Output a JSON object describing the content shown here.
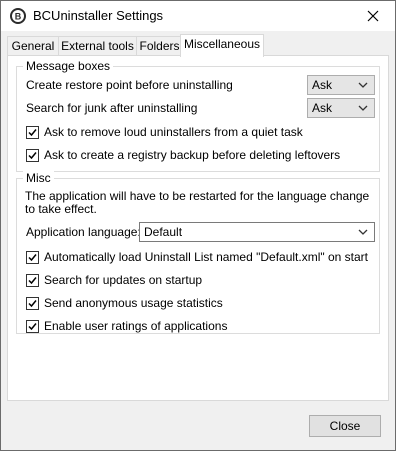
{
  "window": {
    "title": "BCUninstaller Settings",
    "close_glyph": "✕"
  },
  "tabs": [
    {
      "label": "General",
      "active": false
    },
    {
      "label": "External tools",
      "active": false
    },
    {
      "label": "Folders",
      "active": false
    },
    {
      "label": "Miscellaneous",
      "active": true
    }
  ],
  "message_boxes": {
    "group_label": "Message boxes",
    "restore_point_label": "Create restore point before uninstalling",
    "restore_point_value": "Ask",
    "junk_label": "Search for junk after uninstalling",
    "junk_value": "Ask",
    "checkboxes": [
      {
        "label": "Ask to remove loud uninstallers from a quiet task",
        "checked": true
      },
      {
        "label": "Ask to create a registry backup before deleting leftovers",
        "checked": true
      }
    ]
  },
  "misc": {
    "group_label": "Misc",
    "restart_note": "The application will have to be restarted  for the language change to take effect.",
    "language_label": "Application language:",
    "language_value": "Default",
    "checkboxes": [
      {
        "label": "Automatically load Uninstall List named \"Default.xml\" on start",
        "checked": true
      },
      {
        "label": "Search for updates on startup",
        "checked": true
      },
      {
        "label": "Send anonymous usage statistics",
        "checked": true
      },
      {
        "label": "Enable user ratings of applications",
        "checked": true
      }
    ]
  },
  "footer": {
    "close_label": "Close"
  },
  "colors": {
    "window_bg": "#f0f0f0",
    "panel_bg": "#ffffff",
    "combo_bg": "#e5e5e5",
    "button_bg": "#e1e1e1",
    "border": "#adadad"
  },
  "icons": {
    "app": "bcu-logo-icon",
    "close": "close-icon",
    "dropdown": "chevron-down-icon",
    "check": "checkmark-icon"
  }
}
